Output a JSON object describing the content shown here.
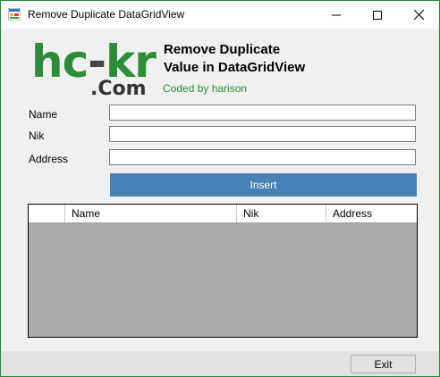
{
  "window": {
    "title": "Remove Duplicate DataGridView",
    "accent": "#1f8a3a"
  },
  "logo": {
    "part1": "hc",
    "dash": "-",
    "part2": "kr",
    "suffix": ".Com"
  },
  "header": {
    "line1": "Remove Duplicate",
    "line2": "Value in DataGridView",
    "credit": "Coded by harison"
  },
  "form": {
    "name_label": "Name",
    "name_value": "",
    "nik_label": "Nik",
    "nik_value": "",
    "address_label": "Address",
    "address_value": "",
    "insert_label": "Insert"
  },
  "grid": {
    "columns": [
      "",
      "Name",
      "Nik",
      "Address"
    ],
    "rows": []
  },
  "footer": {
    "exit_label": "Exit"
  }
}
